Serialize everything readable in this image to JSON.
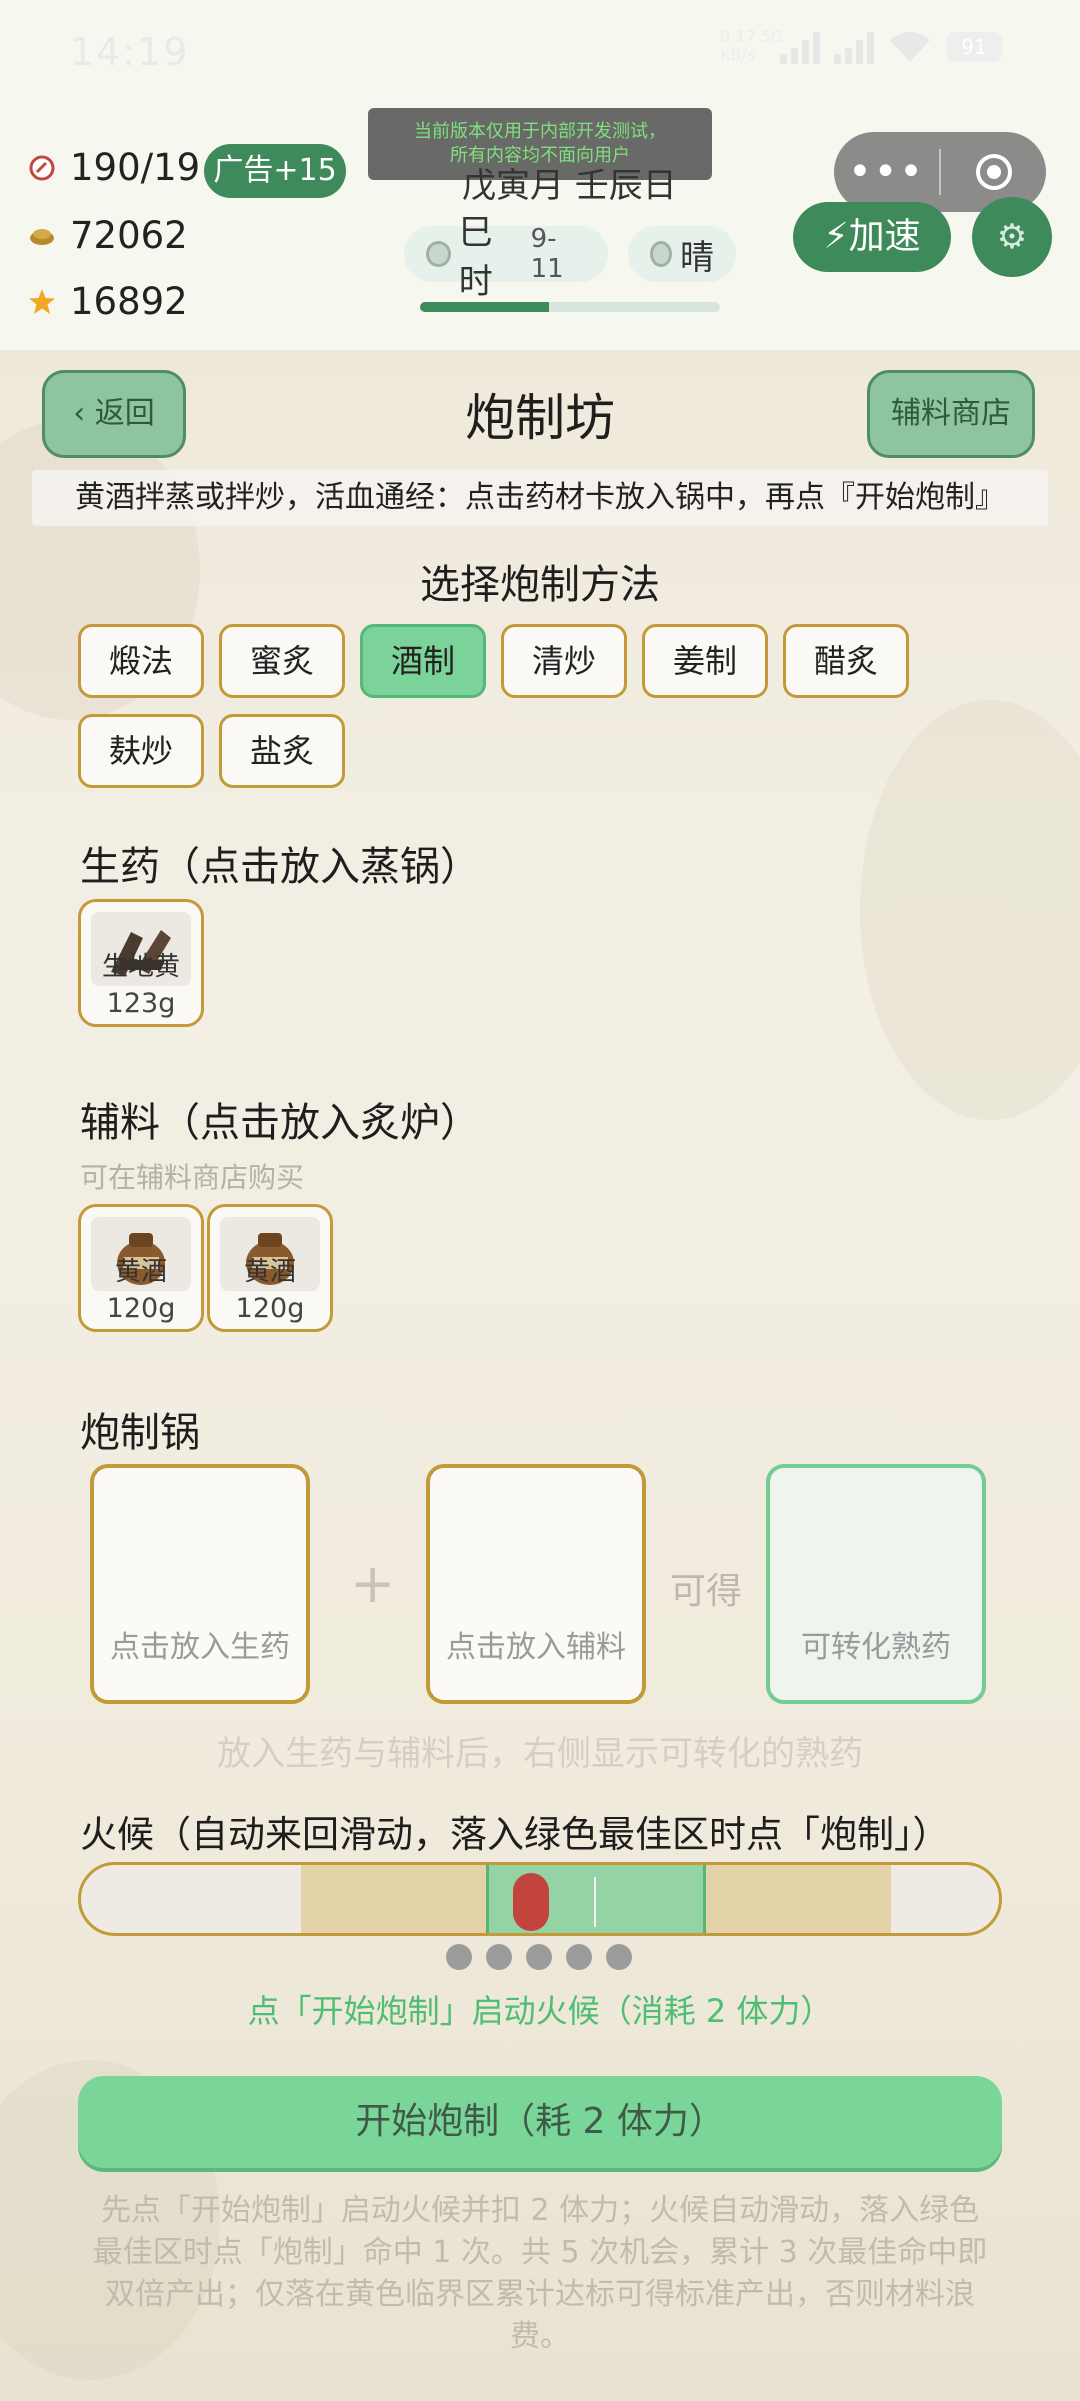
{
  "status_bar": {
    "time": "14:19",
    "network": "0.17 5G\nKB/s",
    "battery": "91"
  },
  "dev_notice": "当前版本仅用于内部开发测试，\n所有内容均不面向用户",
  "stats": {
    "stamina": "190/190",
    "money": "72062",
    "stars": "16892"
  },
  "ad_button": "广告+15",
  "calendar": {
    "ganzhi": "戊寅月 壬辰日",
    "hour": "巳时",
    "hour_range": "9-11",
    "weather": "晴"
  },
  "time_progress": 0.43,
  "speed_button": "⚡加速",
  "header": {
    "back": "‹ 返回",
    "title": "炮制坊",
    "shop": "辅料商店"
  },
  "instruction": "黄酒拌蒸或拌炒，活血通经：点击药材卡放入锅中，再点『开始炮制』",
  "method_section": {
    "title": "选择炮制方法",
    "methods": [
      "煅法",
      "蜜炙",
      "酒制",
      "清炒",
      "姜制",
      "醋炙",
      "麸炒",
      "盐炙"
    ],
    "selected": "酒制"
  },
  "raw_section": {
    "title": "生药（点击放入蒸锅）",
    "items": [
      {
        "name": "生地黄",
        "qty": "123g"
      }
    ]
  },
  "aux_section": {
    "title": "辅料（点击放入炙炉）",
    "subtitle": "可在辅料商店购买",
    "items": [
      {
        "name": "黄酒",
        "qty": "120g"
      },
      {
        "name": "黄酒",
        "qty": "120g"
      }
    ]
  },
  "pot_section": {
    "title": "炮制锅",
    "raw_slot": "点击放入生药",
    "aux_slot": "点击放入辅料",
    "arrow_label": "可得",
    "result_slot": "可转化熟药",
    "hint": "放入生药与辅料后，右侧显示可转化的熟药"
  },
  "fire_section": {
    "title": "火候（自动来回滑动，落入绿色最佳区时点「炮制」）",
    "cursor_position": 0.49,
    "attempts_total": 5,
    "status": "点「开始炮制」启动火候（消耗 2 体力）"
  },
  "start_button": "开始炮制（耗 2 体力）",
  "rules_text": "先点「开始炮制」启动火候并扣 2 体力；火候自动滑动，落入绿色最佳区时点「炮制」命中 1 次。共 5 次机会，累计 3 次最佳命中即双倍产出；仅落在黄色临界区累计达标可得标准产出，否则材料浪费。",
  "colors": {
    "accent_green": "#3e8a5b",
    "selected_method": "#7cd39a",
    "card_border": "#c29a3a",
    "cursor_red": "#c3443c"
  }
}
